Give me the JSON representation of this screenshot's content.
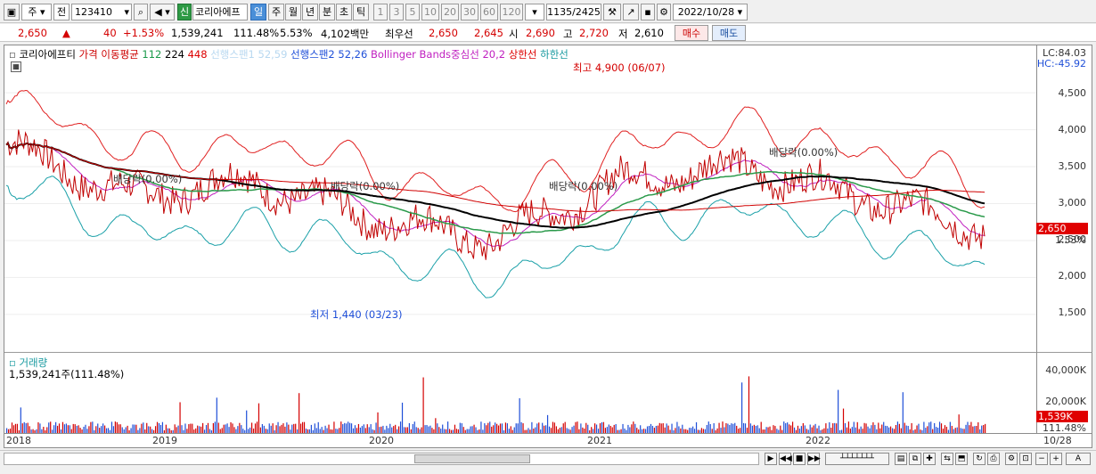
{
  "toolbar": {
    "type_value": "주",
    "range_value": "전",
    "code_value": "123410",
    "badge": "신",
    "stock_name": "코리아에프",
    "periods": [
      "일",
      "주",
      "월",
      "년",
      "분",
      "초",
      "틱"
    ],
    "active_period": "일",
    "intervals": [
      "1",
      "3",
      "5",
      "10",
      "20",
      "30",
      "60",
      "120"
    ],
    "count_display": "1135/2425",
    "date_value": "2022/10/28"
  },
  "quote": {
    "price": "2,650",
    "change_arrow": "▲",
    "change": "40",
    "change_pct": "+1.53%",
    "volume": "1,539,241",
    "volume_ratio": "111.48%",
    "turnover_pct": "5.53%",
    "amount": "4,102백만",
    "best_label": "최우선",
    "best_ask": "2,650",
    "best_bid": "2,645",
    "open_label": "시",
    "open": "2,690",
    "high_label": "고",
    "high": "2,720",
    "low_label": "저",
    "low": "2,610",
    "buy_label": "매수",
    "sell_label": "매도"
  },
  "legend": {
    "name": "코리아에프티",
    "ma_label": "가격 이동평균",
    "ma1": "112",
    "ma2": "224",
    "ma3": "448",
    "hidden": "선행스팬1 52,59",
    "span2": "선행스팬2 52,26",
    "bb": "Bollinger Bands중심선 20,2",
    "upper": "상한선",
    "lower": "하한선"
  },
  "volume_panel": {
    "label": "거래량",
    "value": "1,539,241주(111.48%)"
  },
  "right_axis": {
    "lc": "LC:84.03",
    "hc": "HC:-45.92",
    "ticks": [
      "4,500",
      "4,000",
      "3,500",
      "3,000",
      "2,500",
      "2,000",
      "1,500"
    ],
    "price_tag": "2,650",
    "price_pct": "1.53%",
    "vol_ticks": [
      "40,000K",
      "20,000K"
    ],
    "vol_tag": "1,539K",
    "vol_pct": "111.48%"
  },
  "x_axis": {
    "labels": [
      "2018",
      "2019",
      "2020",
      "2021",
      "2022",
      "10/28"
    ]
  },
  "annotations": {
    "high": "최고 4,900 (06/07)",
    "low": "최저 1,440 (03/23)",
    "div1": "배당락(0.00%)",
    "div2": "배당락(0.00%)",
    "div3": "배당락(0.00%)",
    "div4": "배당락(0.00%)"
  },
  "colors": {
    "accent": "#4a8fd8",
    "up": "#d40000",
    "down": "#1f4fd8",
    "ma_black": "#000000"
  },
  "chart_data": {
    "type": "line",
    "x": [
      "2018",
      "2019",
      "2020",
      "2021",
      "2022",
      "10/28"
    ],
    "series": [
      {
        "values": [
          3800,
          3100,
          3300,
          2800,
          2500,
          3300,
          3500,
          3100,
          2650
        ]
      }
    ],
    "ylim": [
      1100,
      4900
    ]
  }
}
